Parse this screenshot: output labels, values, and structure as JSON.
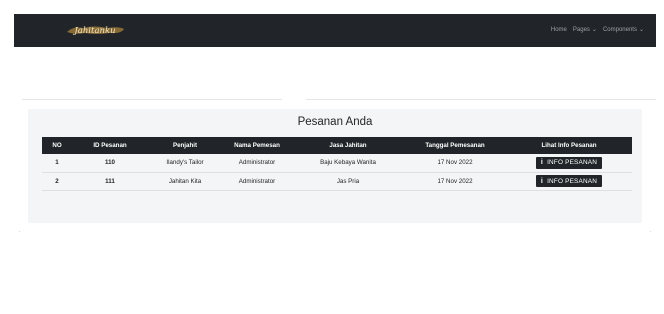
{
  "navbar": {
    "brand": "Jahitanku",
    "links": [
      {
        "label": "Home",
        "has_caret": false
      },
      {
        "label": "Pages",
        "has_caret": true
      },
      {
        "label": "Components",
        "has_caret": true
      }
    ]
  },
  "panel": {
    "title": "Pesanan Anda"
  },
  "table": {
    "headers": [
      "NO",
      "ID Pesanan",
      "Penjahit",
      "Nama Pemesan",
      "Jasa Jahitan",
      "Tanggal Pemesanan",
      "Lihat Info Pesanan"
    ],
    "rows": [
      {
        "no": "1",
        "id": "110",
        "tailor": "Ilandy's Tailor",
        "customer": "Administrator",
        "service": "Baju Kebaya Wanita",
        "date": "17 Nov 2022",
        "action": "INFO PESANAN"
      },
      {
        "no": "2",
        "id": "111",
        "tailor": "Jahitan Kita",
        "customer": "Administrator",
        "service": "Jas Pria",
        "date": "17 Nov 2022",
        "action": "INFO PESANAN"
      }
    ]
  },
  "colors": {
    "navbar_bg": "#212529",
    "panel_bg": "#f4f5f6",
    "logo_accent": "#d9a441"
  },
  "icons": {
    "info": "info-icon",
    "caret": "chevron-down-icon"
  }
}
